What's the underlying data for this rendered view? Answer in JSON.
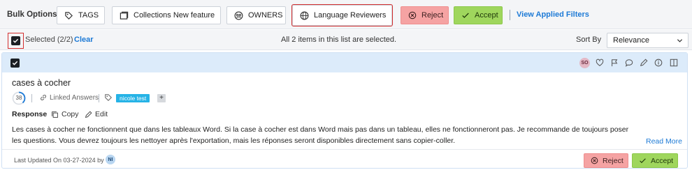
{
  "bulk_options": {
    "label": "Bulk Options :",
    "buttons": {
      "tags": "TAGS",
      "collections": "Collections New feature",
      "owners": "OWNERS",
      "language_reviewers": "Language Reviewers",
      "reject": "Reject",
      "accept": "Accept"
    },
    "view_filters": "View Applied Filters"
  },
  "selection": {
    "selected_text": "Selected (2/2)",
    "clear": "Clear",
    "all_selected_message": "All 2 items in this list are selected.",
    "sort_by_label": "Sort By",
    "sort_value": "Relevance"
  },
  "item": {
    "owner_initials": "SO",
    "title": "cases à cocher",
    "score": "38",
    "linked_answers": "Linked Answers",
    "tag": "nicole test",
    "tag_more": "+",
    "response_label": "Response",
    "copy": "Copy",
    "edit": "Edit",
    "body_line1": "Les cases à cocher ne fonctionnent que dans les tableaux Word. Si la case à cocher est dans Word mais pas dans un tableau, elles ne fonctionneront pas. Je recommande de toujours poser",
    "body_line2": "les questions. Vous devrez toujours les nettoyer après l'exportation, mais les réponses seront disponibles directement sans copier-coller.",
    "read_more": "Read More",
    "last_updated": "Last Updated On 03-27-2024 by",
    "updater_initials": "NI",
    "reject": "Reject",
    "accept": "Accept"
  },
  "colors": {
    "accent": "#1d7ad6",
    "reject": "#f5a3a3",
    "accept": "#9fd65d",
    "highlight": "#d32f2f",
    "tag": "#26b3e6"
  },
  "icons": [
    "tag-icon",
    "collections-icon",
    "owners-icon",
    "globe-icon",
    "reject-icon",
    "check-icon",
    "checkbox-icon",
    "heart-icon",
    "flag-icon",
    "comment-icon",
    "pencil-icon",
    "info-icon",
    "columns-icon",
    "link-icon",
    "copy-icon",
    "chevron-down-icon"
  ]
}
